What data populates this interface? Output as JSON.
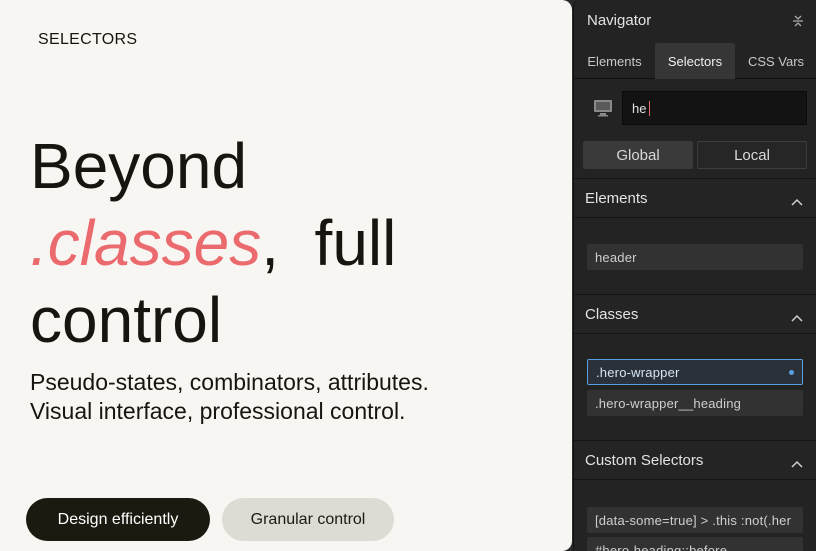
{
  "hero": {
    "eyebrow": "SELECTORS",
    "headline_line1": "Beyond",
    "headline_accent": ".classes",
    "headline_comma": ",",
    "headline_rest": "full",
    "headline_line3": "control",
    "subtext_line1": "Pseudo-states, combinators, attributes.",
    "subtext_line2": "Visual interface, professional control.",
    "primary_button": "Design efficiently",
    "secondary_button": "Granular control",
    "accent_color": "#ea6a6d"
  },
  "navigator": {
    "title": "Navigator",
    "tabs": [
      {
        "label": "Elements"
      },
      {
        "label": "Selectors",
        "active": true
      },
      {
        "label": "CSS Vars"
      }
    ],
    "search": {
      "value": "he",
      "icon": "monitor-icon"
    },
    "scope": {
      "global_label": "Global",
      "local_label": "Local",
      "active": "Global"
    },
    "sections": {
      "elements": {
        "title": "Elements",
        "items": [
          "header"
        ]
      },
      "classes": {
        "title": "Classes",
        "items": [
          ".hero-wrapper",
          ".hero-wrapper__heading"
        ],
        "selected": ".hero-wrapper"
      },
      "custom": {
        "title": "Custom Selectors",
        "items": [
          "[data-some=true] > .this :not(.her",
          "#hero-heading::before"
        ]
      }
    },
    "selection_color": "#5aa0e0"
  }
}
